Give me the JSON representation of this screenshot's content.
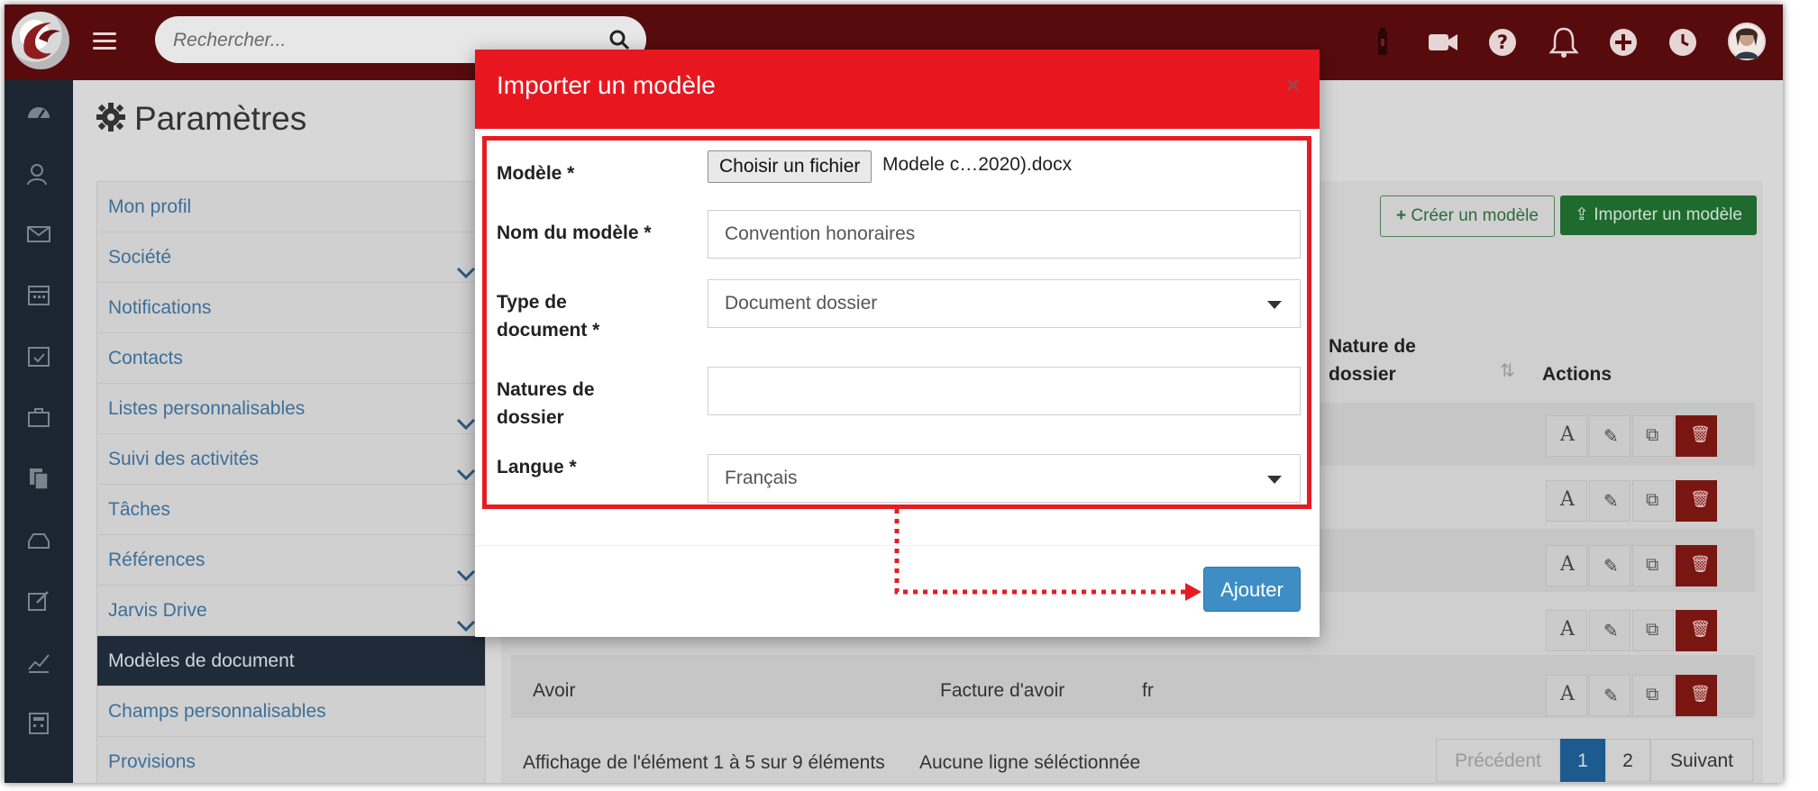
{
  "topbar": {
    "search_placeholder": "Rechercher...",
    "icons": [
      "bottle-icon",
      "video-icon",
      "help-icon",
      "bell-icon",
      "plus-circle-icon",
      "clock-icon",
      "avatar"
    ]
  },
  "sidebar_icons": [
    "dashboard-icon",
    "contacts-icon",
    "mail-icon",
    "calendar-icon",
    "calendar-check-icon",
    "briefcase-icon",
    "documents-icon",
    "inbox-icon",
    "edit-icon",
    "chart-icon",
    "calculator-icon"
  ],
  "page": {
    "title": "Paramètres"
  },
  "settings_menu": [
    {
      "label": "Mon profil",
      "chevron": false,
      "active": false
    },
    {
      "label": "Société",
      "chevron": true,
      "active": false
    },
    {
      "label": "Notifications",
      "chevron": false,
      "active": false
    },
    {
      "label": "Contacts",
      "chevron": false,
      "active": false
    },
    {
      "label": "Listes personnalisables",
      "chevron": true,
      "active": false
    },
    {
      "label": "Suivi des activités",
      "chevron": true,
      "active": false
    },
    {
      "label": "Tâches",
      "chevron": false,
      "active": false
    },
    {
      "label": "Références",
      "chevron": true,
      "active": false
    },
    {
      "label": "Jarvis Drive",
      "chevron": true,
      "active": false
    },
    {
      "label": "Modèles de document",
      "chevron": false,
      "active": true
    },
    {
      "label": "Champs personnalisables",
      "chevron": false,
      "active": false
    },
    {
      "label": "Provisions",
      "chevron": false,
      "active": false
    }
  ],
  "templates_panel": {
    "create_label": "Créer un modèle",
    "import_label": "Importer un modèle",
    "col_nature_line1": "Nature de",
    "col_nature_line2": "dossier",
    "col_actions": "Actions",
    "visible_row": {
      "name": "Avoir",
      "type": "Facture d'avoir",
      "lang": "fr"
    },
    "footer_info": "Affichage de l'élément 1 à 5 sur 9 éléments",
    "footer_selection": "Aucune ligne séléctionnée",
    "pager": {
      "prev": "Précédent",
      "page1": "1",
      "page2": "2",
      "next": "Suivant"
    }
  },
  "modal": {
    "title": "Importer un modèle",
    "close": "×",
    "file_label": "Modèle *",
    "file_button": "Choisir un fichier",
    "file_name": "Modele c…2020).docx",
    "name_label": "Nom du modèle *",
    "name_value": "Convention honoraires",
    "type_label_line1": "Type de",
    "type_label_line2": "document *",
    "type_value": "Document dossier",
    "natures_label_line1": "Natures de",
    "natures_label_line2": "dossier",
    "natures_value": "",
    "lang_label": "Langue *",
    "lang_value": "Français",
    "submit_label": "Ajouter"
  },
  "colors": {
    "topbar": "#570b0d",
    "modal_header": "#e8171f",
    "highlight": "#e41c23",
    "submit": "#3e8ec5",
    "delete": "#7a1612"
  }
}
